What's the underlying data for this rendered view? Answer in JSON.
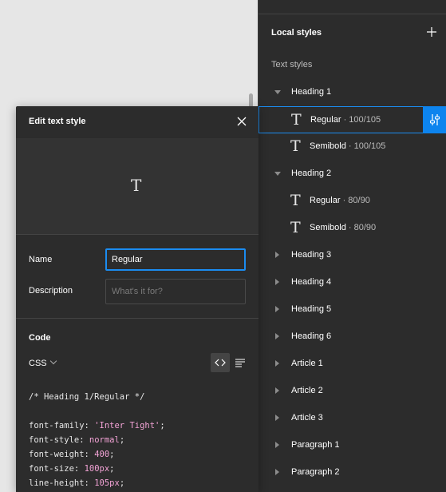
{
  "panel": {
    "title": "Local styles",
    "add_icon": "plus-icon",
    "section_label": "Text styles",
    "rows": [
      {
        "kind": "group",
        "label": "Heading 1",
        "expanded": true
      },
      {
        "kind": "style",
        "name": "Regular",
        "meta": " · 100/105",
        "selected": true
      },
      {
        "kind": "style",
        "name": "Semibold",
        "meta": " · 100/105"
      },
      {
        "kind": "group",
        "label": "Heading 2",
        "expanded": true
      },
      {
        "kind": "style",
        "name": "Regular",
        "meta": " · 80/90"
      },
      {
        "kind": "style",
        "name": "Semibold",
        "meta": " · 80/90"
      },
      {
        "kind": "group",
        "label": "Heading 3"
      },
      {
        "kind": "group",
        "label": "Heading 4"
      },
      {
        "kind": "group",
        "label": "Heading 5"
      },
      {
        "kind": "group",
        "label": "Heading 6"
      },
      {
        "kind": "group",
        "label": "Article 1"
      },
      {
        "kind": "group",
        "label": "Article 2"
      },
      {
        "kind": "group",
        "label": "Article 3"
      },
      {
        "kind": "group",
        "label": "Paragraph 1"
      },
      {
        "kind": "group",
        "label": "Paragraph 2"
      }
    ]
  },
  "dialog": {
    "title": "Edit text style",
    "preview_glyph": "T",
    "name_label": "Name",
    "name_value": "Regular",
    "description_label": "Description",
    "description_placeholder": "What's it for?",
    "code_header": "Code",
    "language": "CSS",
    "code": {
      "comment": "/* Heading 1/Regular */",
      "lines": [
        {
          "prop": "font-family",
          "value": "'Inter Tight'"
        },
        {
          "prop": "font-style",
          "value": "normal"
        },
        {
          "prop": "font-weight",
          "value": "400"
        },
        {
          "prop": "font-size",
          "value": "100px"
        },
        {
          "prop": "line-height",
          "value": "105px"
        }
      ]
    }
  },
  "colors": {
    "accent": "#0d84ee",
    "panel_bg": "#2c2c2c",
    "code_value": "#f3a3d6"
  }
}
